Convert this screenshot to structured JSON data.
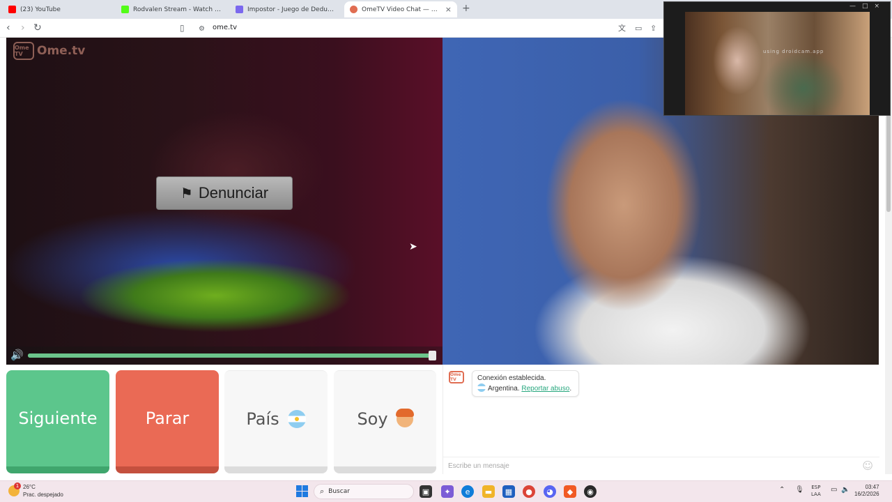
{
  "tabs": [
    {
      "title": "(23) YouTube",
      "favicon": "youtube-icon",
      "color": "#ff0000"
    },
    {
      "title": "Rodvalen Stream - Watch Live on Kick",
      "favicon": "kick-icon",
      "color": "#53fc18"
    },
    {
      "title": "Impostor - Juego de Deducción Online",
      "favicon": "impostor-icon",
      "color": "#7b68ee"
    },
    {
      "title": "OmeTV Video Chat — Omegle",
      "favicon": "ometv-icon",
      "color": "#e06d52",
      "close": "×"
    }
  ],
  "newtab_label": "+",
  "address": {
    "url": "ome.tv"
  },
  "stranger_video": {
    "logo_badge": "Ome TV",
    "logo_word": "Ome.tv",
    "report_label": "Denunciar",
    "volume_level": 1.0
  },
  "pip": {
    "cam_label": "using droidcam.app",
    "controls": "—□×"
  },
  "buttons": {
    "next": "Siguiente",
    "stop": "Parar",
    "country": "País",
    "iam": "Soy"
  },
  "chat": {
    "logo": "Ome TV",
    "status": "Conexión establecida.",
    "country": "Argentina.",
    "report_link": "Reportar abuso",
    "report_suffix": ".",
    "input_placeholder": "Escribe un mensaje"
  },
  "taskbar": {
    "weather_temp": "26°C",
    "weather_desc": "Prac. despejado",
    "weather_badge": "1",
    "search_placeholder": "Buscar",
    "lang_top": "ESP",
    "lang_bottom": "LAA",
    "time": "03:47",
    "date": "16/2/2026"
  },
  "colors": {
    "next": "#5cc68c",
    "stop": "#ea6a55",
    "link": "#27a77e"
  }
}
